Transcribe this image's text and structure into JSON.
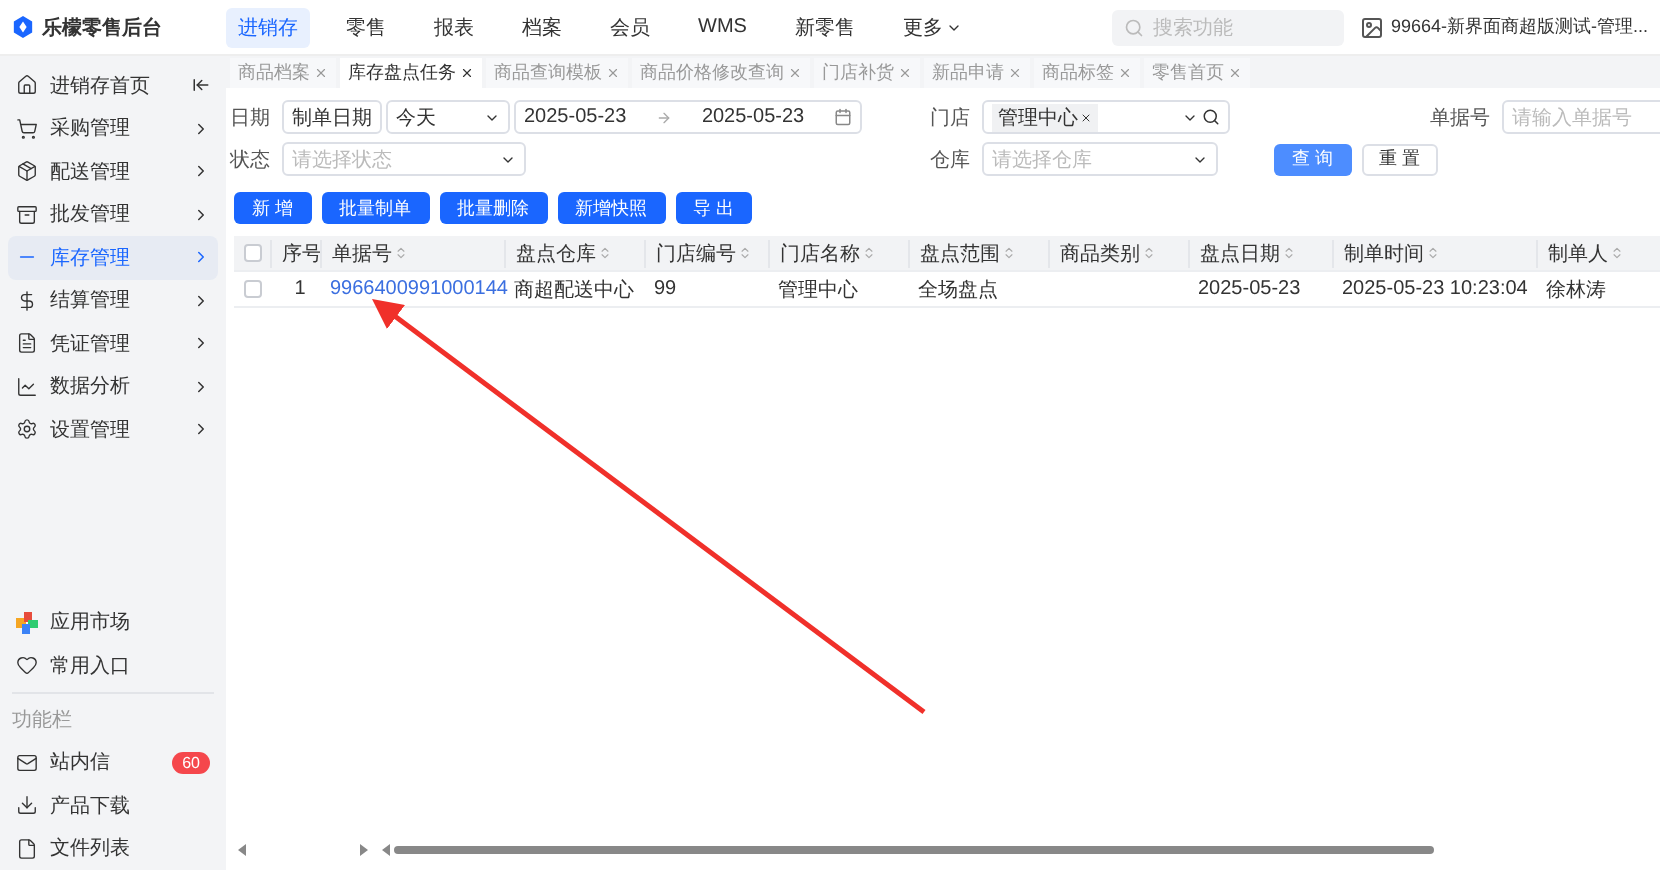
{
  "app": {
    "logo_text": "乐檬零售后台"
  },
  "top_nav": [
    {
      "label": "进销存",
      "selected": true
    },
    {
      "label": "零售",
      "selected": false
    },
    {
      "label": "报表",
      "selected": false
    },
    {
      "label": "档案",
      "selected": false
    },
    {
      "label": "会员",
      "selected": false
    },
    {
      "label": "WMS",
      "selected": false
    },
    {
      "label": "新零售",
      "selected": false
    },
    {
      "label": "更多",
      "selected": false,
      "kind": "dropdown"
    }
  ],
  "search": {
    "placeholder": "搜索功能"
  },
  "user": {
    "name": "99664-新界面商超版测试-管理..."
  },
  "sidebar": {
    "items": [
      {
        "label": "进销存首页",
        "selected": false
      },
      {
        "label": "采购管理",
        "selected": false
      },
      {
        "label": "配送管理",
        "selected": false
      },
      {
        "label": "批发管理",
        "selected": false
      },
      {
        "label": "库存管理",
        "selected": true
      },
      {
        "label": "结算管理",
        "selected": false
      },
      {
        "label": "凭证管理",
        "selected": false
      },
      {
        "label": "数据分析",
        "selected": false
      },
      {
        "label": "设置管理",
        "selected": false
      }
    ],
    "bottom_items": [
      {
        "label": "应用市场"
      },
      {
        "label": "常用入口"
      }
    ],
    "section_title": "功能栏",
    "function_items": [
      {
        "label": "站内信",
        "badge": "60"
      },
      {
        "label": "产品下载"
      },
      {
        "label": "文件列表"
      }
    ]
  },
  "tabs": [
    {
      "label": "商品档案",
      "selected": false
    },
    {
      "label": "库存盘点任务",
      "selected": true
    },
    {
      "label": "商品查询模板",
      "selected": false
    },
    {
      "label": "商品价格修改查询",
      "selected": false
    },
    {
      "label": "门店补货",
      "selected": false
    },
    {
      "label": "新品申请",
      "selected": false
    },
    {
      "label": "商品标签",
      "selected": false
    },
    {
      "label": "零售首页",
      "selected": false
    }
  ],
  "filters": {
    "date_label": "日期",
    "date_type": "制单日期",
    "date_preset": "今天",
    "date_start": "2025-05-23",
    "date_end": "2025-05-23",
    "store_label": "门店",
    "store_tag": "管理中心",
    "doc_label": "单据号",
    "doc_placeholder": "请输入单据号",
    "status_label": "状态",
    "status_placeholder": "请选择状态",
    "warehouse_label": "仓库",
    "warehouse_placeholder": "请选择仓库",
    "query_button": "查 询",
    "reset_button": "重 置"
  },
  "actions": [
    "新 增",
    "批量制单",
    "批量删除",
    "新增快照",
    "导 出"
  ],
  "table": {
    "select_all_checked": false,
    "columns": [
      "序号",
      "单据号",
      "盘点仓库",
      "门店编号",
      "门店名称",
      "盘点范围",
      "商品类别",
      "盘点日期",
      "制单时间",
      "制单人"
    ],
    "rows": [
      {
        "checked": false,
        "cells": [
          "1",
          "9966400991000144",
          "商超配送中心",
          "99",
          "管理中心",
          "全场盘点",
          "",
          "2025-05-23",
          "2025-05-23 10:23:04",
          "徐林涛"
        ]
      }
    ]
  }
}
